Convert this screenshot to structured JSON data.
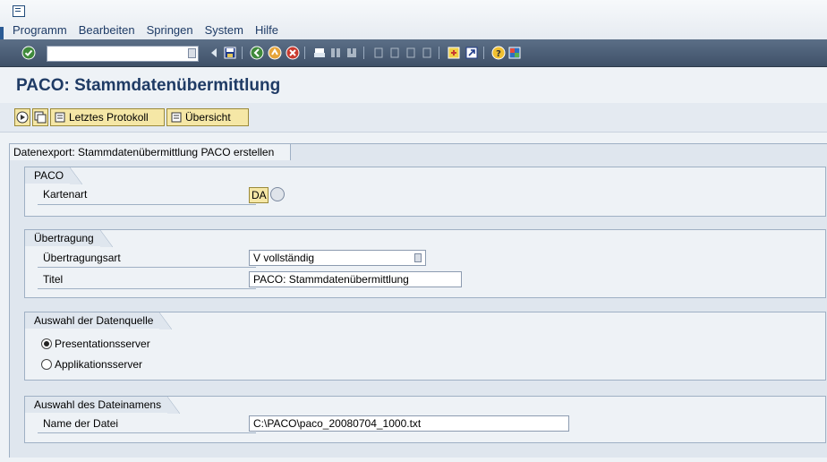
{
  "menu": {
    "items": [
      "Programm",
      "Bearbeiten",
      "Springen",
      "System",
      "Hilfe"
    ]
  },
  "toolbar": {
    "command_field_value": ""
  },
  "page": {
    "title": "PACO: Stammdatenübermittlung"
  },
  "app_toolbar": {
    "last_log_label": "Letztes Protokoll",
    "overview_label": "Übersicht"
  },
  "content": {
    "header": "Datenexport: Stammdatenübermittlung PACO erstellen",
    "paco": {
      "title": "PACO",
      "kartenart_label": "Kartenart",
      "kartenart_value": "DA"
    },
    "uebertragung": {
      "title": "Übertragung",
      "art_label": "Übertragungsart",
      "art_value": "V vollständig",
      "titel_label": "Titel",
      "titel_value": "PACO: Stammdatenübermittlung"
    },
    "datenquelle": {
      "title": "Auswahl der Datenquelle",
      "option1": "Presentationsserver",
      "option2": "Applikationsserver",
      "selected": "Presentationsserver"
    },
    "dateiname": {
      "title": "Auswahl des Dateinamens",
      "label": "Name der Datei",
      "value": "C:\\PACO\\paco_20080704_1000.txt"
    }
  },
  "colors": {
    "title": "#1f3b65",
    "toolbar_bg": "#4a5d75",
    "button_bg": "#f5e7a6"
  }
}
